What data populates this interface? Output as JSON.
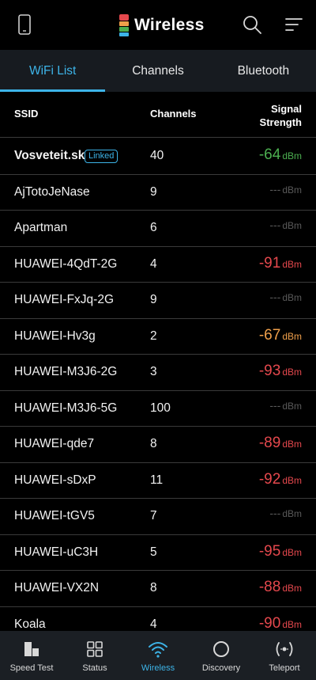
{
  "app": {
    "title": "Wireless"
  },
  "tabs": [
    {
      "label": "WiFi List",
      "active": true
    },
    {
      "label": "Channels",
      "active": false
    },
    {
      "label": "Bluetooth",
      "active": false
    }
  ],
  "table": {
    "col_ssid": "SSID",
    "col_channels": "Channels",
    "col_signal_line1": "Signal",
    "col_signal_line2": "Strength",
    "rows": [
      {
        "ssid": "Vosveteit.sk",
        "badge": "Linked",
        "channel": "40",
        "signal": "-64",
        "unit": "dBm",
        "color": "#4caf50"
      },
      {
        "ssid": "AjTotoJeNase",
        "channel": "9",
        "signal": "---",
        "unit": "dBm",
        "color": "#5a5a5a"
      },
      {
        "ssid": "Apartman",
        "channel": "6",
        "signal": "---",
        "unit": "dBm",
        "color": "#5a5a5a"
      },
      {
        "ssid": "HUAWEI-4QdT-2G",
        "channel": "4",
        "signal": "-91",
        "unit": "dBm",
        "color": "#e5484d"
      },
      {
        "ssid": "HUAWEI-FxJq-2G",
        "channel": "9",
        "signal": "---",
        "unit": "dBm",
        "color": "#5a5a5a"
      },
      {
        "ssid": "HUAWEI-Hv3g",
        "channel": "2",
        "signal": "-67",
        "unit": "dBm",
        "color": "#f0a04b"
      },
      {
        "ssid": "HUAWEI-M3J6-2G",
        "channel": "3",
        "signal": "-93",
        "unit": "dBm",
        "color": "#e5484d"
      },
      {
        "ssid": "HUAWEI-M3J6-5G",
        "channel": "100",
        "signal": "---",
        "unit": "dBm",
        "color": "#5a5a5a"
      },
      {
        "ssid": "HUAWEI-qde7",
        "channel": "8",
        "signal": "-89",
        "unit": "dBm",
        "color": "#e5484d"
      },
      {
        "ssid": "HUAWEI-sDxP",
        "channel": "11",
        "signal": "-92",
        "unit": "dBm",
        "color": "#e5484d"
      },
      {
        "ssid": "HUAWEI-tGV5",
        "channel": "7",
        "signal": "---",
        "unit": "dBm",
        "color": "#5a5a5a"
      },
      {
        "ssid": "HUAWEI-uC3H",
        "channel": "5",
        "signal": "-95",
        "unit": "dBm",
        "color": "#e5484d"
      },
      {
        "ssid": "HUAWEI-VX2N",
        "channel": "8",
        "signal": "-88",
        "unit": "dBm",
        "color": "#e5484d"
      },
      {
        "ssid": "Koala",
        "channel": "4",
        "signal": "-90",
        "unit": "dBm",
        "color": "#e5484d"
      }
    ]
  },
  "bottom_nav": [
    {
      "label": "Speed Test",
      "icon": "speed-test-icon",
      "active": false
    },
    {
      "label": "Status",
      "icon": "grid-icon",
      "active": false
    },
    {
      "label": "Wireless",
      "icon": "wifi-icon",
      "active": true
    },
    {
      "label": "Discovery",
      "icon": "circle-icon",
      "active": false
    },
    {
      "label": "Teleport",
      "icon": "teleport-icon",
      "active": false
    }
  ],
  "colors": {
    "accent": "#3db4e8",
    "good": "#4caf50",
    "fair": "#f0a04b",
    "poor": "#e5484d",
    "unknown": "#5a5a5a"
  }
}
